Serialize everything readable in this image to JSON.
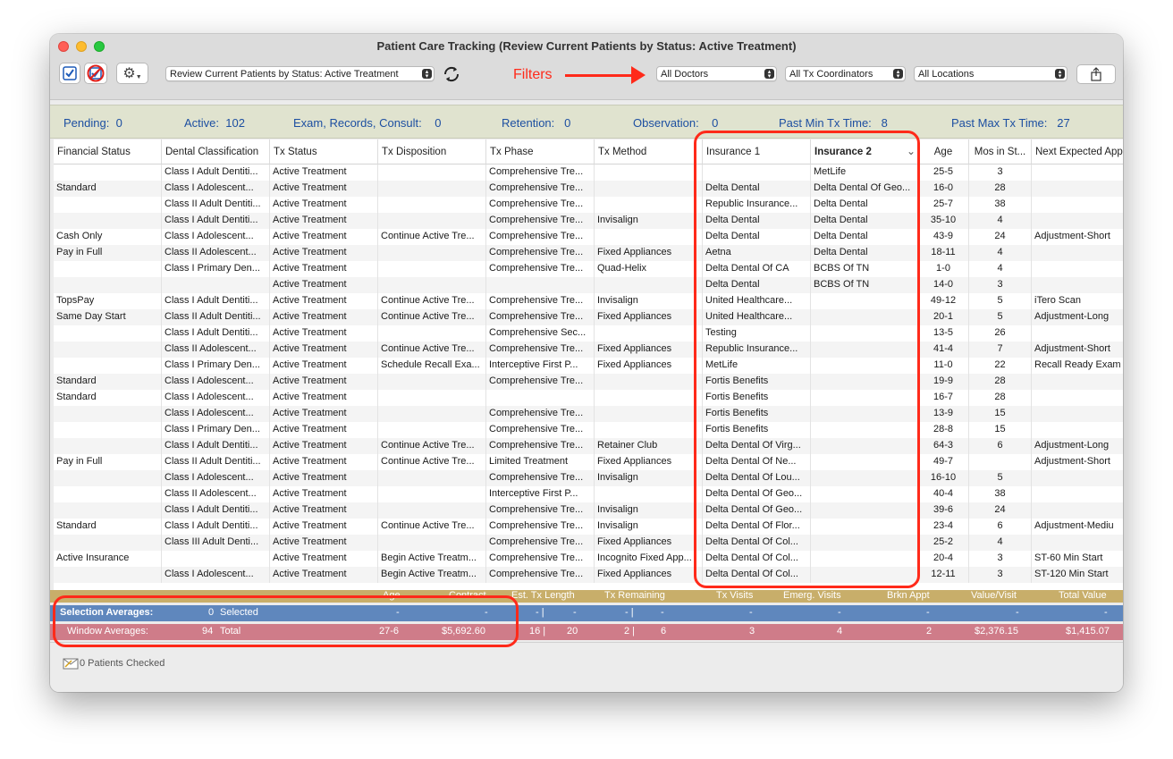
{
  "window": {
    "title": "Patient Care Tracking (Review Current Patients by Status: Active Treatment)"
  },
  "toolbar": {
    "view_select": "Review Current Patients by Status: Active Treatment",
    "filters_label": "Filters",
    "doctor_select": "All Doctors",
    "coordinator_select": "All Tx Coordinators",
    "location_select": "All Locations"
  },
  "summary": [
    {
      "label": "Pending:",
      "value": "0"
    },
    {
      "label": "Active:",
      "value": "102"
    },
    {
      "label": "Exam, Records, Consult:",
      "value": "0"
    },
    {
      "label": "Retention:",
      "value": "0"
    },
    {
      "label": "Observation:",
      "value": "0"
    },
    {
      "label": "Past Min Tx Time:",
      "value": "8"
    },
    {
      "label": "Past Max Tx Time:",
      "value": "27"
    }
  ],
  "columns": [
    "Financial Status",
    "Dental Classification",
    "Tx Status",
    "Tx Disposition",
    "Tx Phase",
    "Tx Method",
    "Insurance 1",
    "Insurance 2",
    "Age",
    "Mos in St...",
    "Next Expected App"
  ],
  "rows": [
    [
      "",
      "Class I Adult Dentiti...",
      "Active Treatment",
      "",
      "Comprehensive Tre...",
      "",
      "",
      "MetLife",
      "25-5",
      "3",
      ""
    ],
    [
      "Standard",
      "Class I Adolescent...",
      "Active Treatment",
      "",
      "Comprehensive Tre...",
      "",
      "Delta Dental",
      "Delta Dental Of Geo...",
      "16-0",
      "28",
      ""
    ],
    [
      "",
      "Class II Adult Dentiti...",
      "Active Treatment",
      "",
      "Comprehensive Tre...",
      "",
      "Republic Insurance...",
      "Delta Dental",
      "25-7",
      "38",
      ""
    ],
    [
      "",
      "Class I Adult Dentiti...",
      "Active Treatment",
      "",
      "Comprehensive Tre...",
      "Invisalign",
      "Delta Dental",
      "Delta Dental",
      "35-10",
      "4",
      ""
    ],
    [
      "Cash Only",
      "Class I Adolescent...",
      "Active Treatment",
      "Continue Active Tre...",
      "Comprehensive Tre...",
      "",
      "Delta Dental",
      "Delta Dental",
      "43-9",
      "24",
      "Adjustment-Short"
    ],
    [
      "Pay in Full",
      "Class II Adolescent...",
      "Active Treatment",
      "",
      "Comprehensive Tre...",
      "Fixed Appliances",
      "Aetna",
      "Delta Dental",
      "18-11",
      "4",
      ""
    ],
    [
      "",
      "Class I Primary Den...",
      "Active Treatment",
      "",
      "Comprehensive Tre...",
      "Quad-Helix",
      "Delta Dental Of CA",
      "BCBS Of TN",
      "1-0",
      "4",
      ""
    ],
    [
      "",
      "",
      "Active Treatment",
      "",
      "",
      "",
      "Delta Dental",
      "BCBS Of TN",
      "14-0",
      "3",
      ""
    ],
    [
      "TopsPay",
      "Class I Adult Dentiti...",
      "Active Treatment",
      "Continue Active Tre...",
      "Comprehensive Tre...",
      "Invisalign",
      "United Healthcare...",
      "",
      "49-12",
      "5",
      "iTero Scan"
    ],
    [
      "Same Day Start",
      "Class II Adult Dentiti...",
      "Active Treatment",
      "Continue Active Tre...",
      "Comprehensive Tre...",
      "Fixed Appliances",
      "United Healthcare...",
      "",
      "20-1",
      "5",
      "Adjustment-Long"
    ],
    [
      "",
      "Class I Adult Dentiti...",
      "Active Treatment",
      "",
      "Comprehensive Sec...",
      "",
      "Testing",
      "",
      "13-5",
      "26",
      ""
    ],
    [
      "",
      "Class II Adolescent...",
      "Active Treatment",
      "Continue Active Tre...",
      "Comprehensive Tre...",
      "Fixed Appliances",
      "Republic Insurance...",
      "",
      "41-4",
      "7",
      "Adjustment-Short"
    ],
    [
      "",
      "Class I Primary Den...",
      "Active Treatment",
      "Schedule Recall Exa...",
      "Interceptive First P...",
      "Fixed Appliances",
      "MetLife",
      "",
      "11-0",
      "22",
      "Recall Ready Exam"
    ],
    [
      "Standard",
      "Class I Adolescent...",
      "Active Treatment",
      "",
      "Comprehensive Tre...",
      "",
      "Fortis Benefits",
      "",
      "19-9",
      "28",
      ""
    ],
    [
      "Standard",
      "Class I Adolescent...",
      "Active Treatment",
      "",
      "",
      "",
      "Fortis Benefits",
      "",
      "16-7",
      "28",
      ""
    ],
    [
      "",
      "Class I Adolescent...",
      "Active Treatment",
      "",
      "Comprehensive Tre...",
      "",
      "Fortis Benefits",
      "",
      "13-9",
      "15",
      ""
    ],
    [
      "",
      "Class I Primary Den...",
      "Active Treatment",
      "",
      "Comprehensive Tre...",
      "",
      "Fortis Benefits",
      "",
      "28-8",
      "15",
      ""
    ],
    [
      "",
      "Class I Adult Dentiti...",
      "Active Treatment",
      "Continue Active Tre...",
      "Comprehensive Tre...",
      "Retainer Club",
      "Delta Dental Of Virg...",
      "",
      "64-3",
      "6",
      "Adjustment-Long"
    ],
    [
      "Pay in Full",
      "Class II Adult Dentiti...",
      "Active Treatment",
      "Continue Active Tre...",
      "Limited Treatment",
      "Fixed Appliances",
      "Delta Dental Of Ne...",
      "",
      "49-7",
      "",
      "Adjustment-Short"
    ],
    [
      "",
      "Class I Adolescent...",
      "Active Treatment",
      "",
      "Comprehensive Tre...",
      "Invisalign",
      "Delta Dental Of Lou...",
      "",
      "16-10",
      "5",
      ""
    ],
    [
      "",
      "Class II Adolescent...",
      "Active Treatment",
      "",
      "Interceptive First P...",
      "",
      "Delta Dental Of Geo...",
      "",
      "40-4",
      "38",
      ""
    ],
    [
      "",
      "Class I Adult Dentiti...",
      "Active Treatment",
      "",
      "Comprehensive Tre...",
      "Invisalign",
      "Delta Dental Of Geo...",
      "",
      "39-6",
      "24",
      ""
    ],
    [
      "Standard",
      "Class I Adult Dentiti...",
      "Active Treatment",
      "Continue Active Tre...",
      "Comprehensive Tre...",
      "Invisalign",
      "Delta Dental Of Flor...",
      "",
      "23-4",
      "6",
      "Adjustment-Mediu"
    ],
    [
      "",
      "Class III Adult Denti...",
      "Active Treatment",
      "",
      "Comprehensive Tre...",
      "Fixed Appliances",
      "Delta Dental Of Col...",
      "",
      "25-2",
      "4",
      ""
    ],
    [
      "Active Insurance",
      "",
      "Active Treatment",
      "Begin Active Treatm...",
      "Comprehensive Tre...",
      "Incognito Fixed App...",
      "Delta Dental Of Col...",
      "",
      "20-4",
      "3",
      "ST-60 Min Start"
    ],
    [
      "",
      "Class I Adolescent...",
      "Active Treatment",
      "Begin Active Treatm...",
      "Comprehensive Tre...",
      "Fixed Appliances",
      "Delta Dental Of Col...",
      "",
      "12-11",
      "3",
      "ST-120 Min Start"
    ]
  ],
  "footer_headers": [
    "Age",
    "Contract",
    "Est. Tx Length",
    "Tx Remaining",
    "Tx Visits",
    "Emerg. Visits",
    "Brkn Appt",
    "Value/Visit",
    "Total Value"
  ],
  "selection_averages": {
    "label": "Selection Averages:",
    "count": "0",
    "count_label": "Selected",
    "values": [
      "-",
      "-",
      "- |",
      "-",
      "- |",
      "-",
      "-",
      "-",
      "-",
      "-",
      "-"
    ]
  },
  "window_averages": {
    "label": "Window Averages:",
    "count": "94",
    "count_label": "Total",
    "values": [
      "27-6",
      "$5,692.60",
      "16 |",
      "20",
      "2 |",
      "6",
      "3",
      "4",
      "2",
      "$2,376.15",
      "$1,415.07"
    ]
  },
  "status": {
    "patients_checked": "0 Patients Checked"
  },
  "colors": {
    "highlight": "#ff2a1a",
    "summary_text": "#1d4fa1",
    "selection_bar": "#5f87bd",
    "window_bar": "#cf7c89",
    "footer_header": "#c8ae6a"
  }
}
